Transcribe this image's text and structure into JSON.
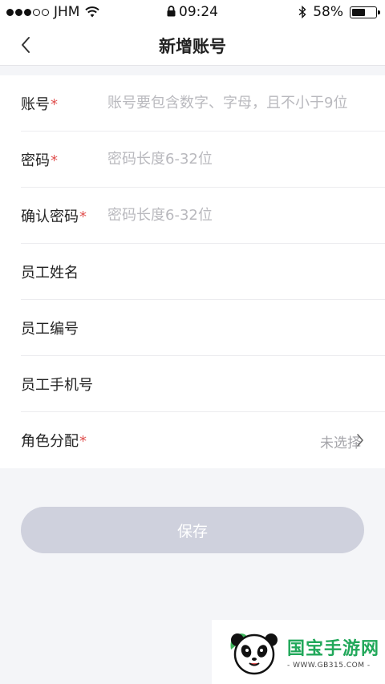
{
  "status_bar": {
    "carrier": "JHM",
    "time": "09:24",
    "battery_percent": "58%",
    "battery_level": 0.58,
    "signal_dots_filled": 3,
    "signal_dots_total": 5
  },
  "nav": {
    "title": "新增账号",
    "back_icon": "chevron-left-icon"
  },
  "form": {
    "fields": [
      {
        "label": "账号",
        "required": true,
        "placeholder": "账号要包含数字、字母，且不小于9位",
        "value": ""
      },
      {
        "label": "密码",
        "required": true,
        "placeholder": "密码长度6-32位",
        "value": ""
      },
      {
        "label": "确认密码",
        "required": true,
        "placeholder": "密码长度6-32位",
        "value": ""
      },
      {
        "label": "员工姓名",
        "required": false,
        "placeholder": "",
        "value": ""
      },
      {
        "label": "员工编号",
        "required": false,
        "placeholder": "",
        "value": ""
      },
      {
        "label": "员工手机号",
        "required": false,
        "placeholder": "",
        "value": ""
      }
    ],
    "role": {
      "label": "角色分配",
      "required": true,
      "value": "未选择"
    },
    "required_mark": "*"
  },
  "actions": {
    "save_label": "保存"
  },
  "watermark": {
    "brand": "国宝手游网",
    "url": "- WWW.GB315.COM -"
  },
  "colors": {
    "required": "#e0504f",
    "save_button_disabled": "#cfd1dd",
    "watermark_green": "#21a85a"
  }
}
